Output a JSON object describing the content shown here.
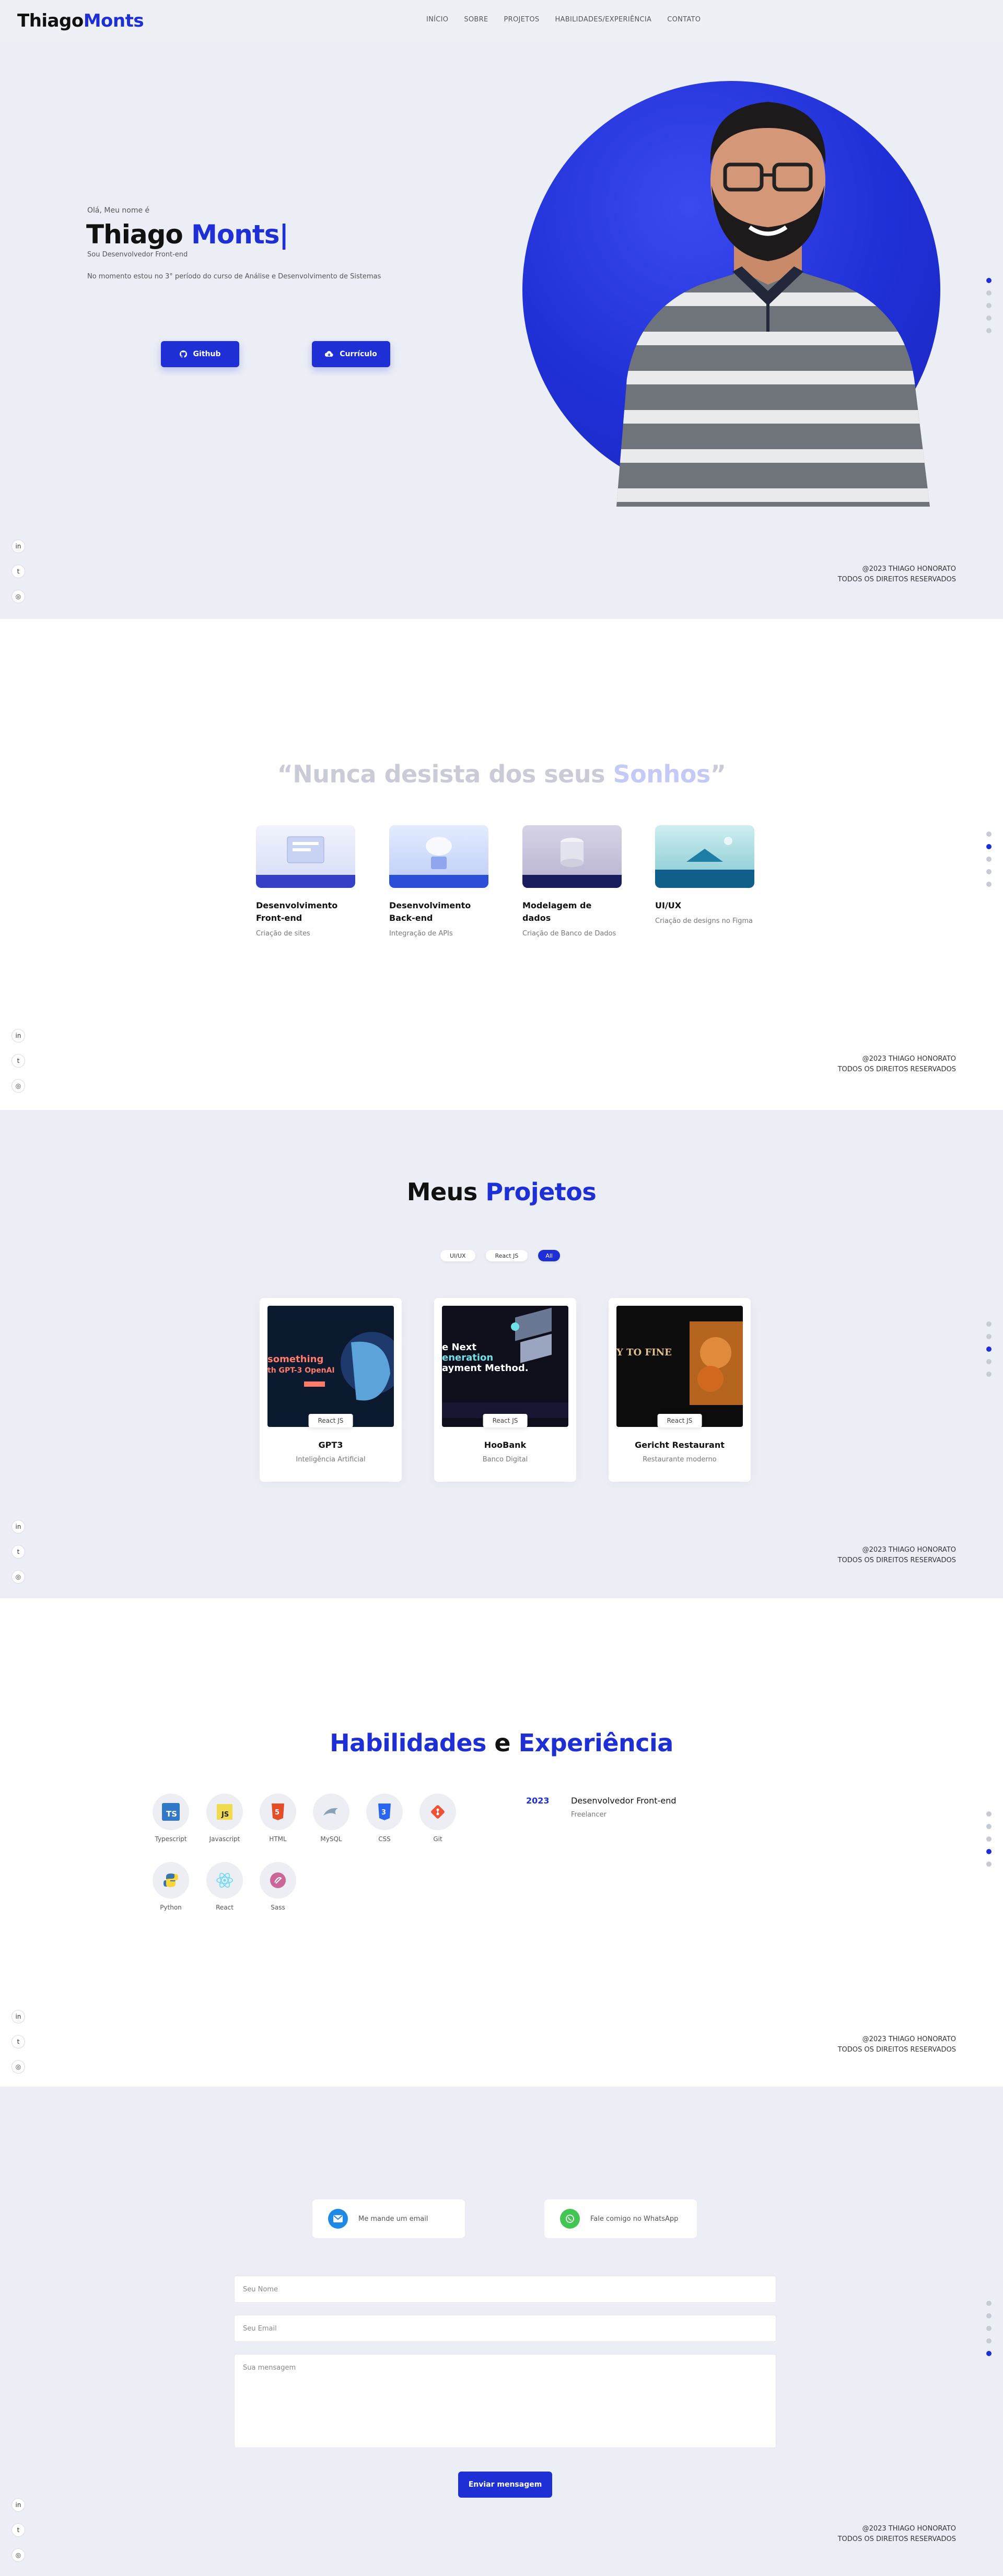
{
  "header": {
    "logo_plain": "Thiago",
    "logo_accent": "Monts",
    "nav": [
      "INÍCIO",
      "SOBRE",
      "PROJETOS",
      "HABILIDADES/EXPERIÊNCIA",
      "CONTATO"
    ]
  },
  "hero": {
    "greeting": "Olá, Meu nome é",
    "name_plain": "Thiago ",
    "name_accent": "Monts|",
    "role": "Sou Desenvolvedor Front-end",
    "description": "No momento estou no 3° período do curso de Análise e Desenvolvimento de Sistemas",
    "btn_github": "Github",
    "btn_cv": "Currículo"
  },
  "footer": {
    "line1": "@2023 THIAGO HONORATO",
    "line2": "TODOS OS DIREITOS RESERVADOS"
  },
  "about": {
    "quote_open": "“",
    "quote_plain": "Nunca desista dos seus ",
    "quote_accent": "Sonhos",
    "quote_close": "”",
    "services": [
      {
        "title": "Desenvolvimento Front-end",
        "desc": "Criação de sites"
      },
      {
        "title": "Desenvolvimento Back-end",
        "desc": "Integração de APIs"
      },
      {
        "title": "Modelagem de dados",
        "desc": "Criação de Banco de Dados"
      },
      {
        "title": "UI/UX",
        "desc": "Criação de designs no Figma"
      }
    ]
  },
  "projects": {
    "title_plain": "Meus ",
    "title_accent": "Projetos",
    "filters": [
      "UI/UX",
      "React JS",
      "All"
    ],
    "items": [
      {
        "badge": "React JS",
        "name": "GPT3",
        "desc": "Inteligência Artificial",
        "shot_text_1": "something",
        "shot_text_2": "th GPT-3 OpenAI"
      },
      {
        "badge": "React JS",
        "name": "HooBank",
        "desc": "Banco Digital",
        "shot_text_1": "e Next",
        "shot_text_2": "eneration",
        "shot_text_3": "ayment Method."
      },
      {
        "badge": "React JS",
        "name": "Gericht Restaurant",
        "desc": "Restaurante moderno",
        "shot_text_1": "Y TO FINE"
      }
    ]
  },
  "skills": {
    "title_accent1": "Habilidades",
    "title_plain": " e ",
    "title_accent2": "Experiência",
    "items": [
      "Typescript",
      "Javascript",
      "HTML",
      "MySQL",
      "CSS",
      "Git",
      "Python",
      "React",
      "Sass"
    ],
    "experience": {
      "year": "2023",
      "role": "Desenvolvedor Front-end",
      "company": "Freelancer"
    }
  },
  "contact": {
    "email": "Me mande um email",
    "whatsapp": "Fale comigo no WhatsApp",
    "name_ph": "Seu Nome",
    "email_ph": "Seu Email",
    "message_ph": "Sua mensagem",
    "send": "Enviar mensagem"
  },
  "colors": {
    "accent": "#1f2fd6",
    "background": "#ebeef5"
  }
}
